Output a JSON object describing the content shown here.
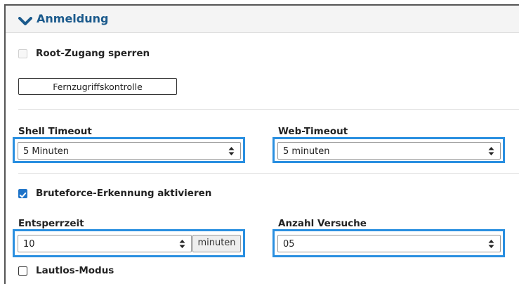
{
  "section": {
    "title": "Anmeldung",
    "icon": "chevron-down-icon"
  },
  "root_access": {
    "label": "Root-Zugang sperren",
    "checked": false,
    "disabled": true
  },
  "remote_button": {
    "label": "Fernzugriffskontrolle"
  },
  "shell_timeout": {
    "label": "Shell Timeout",
    "value": "5 Minuten"
  },
  "web_timeout": {
    "label": "Web-Timeout",
    "value": "5 minuten"
  },
  "bruteforce": {
    "label": "Bruteforce-Erkennung aktivieren",
    "checked": true
  },
  "unlock_time": {
    "label": "Entsperrzeit",
    "value": "10",
    "unit": "minuten"
  },
  "attempts": {
    "label": "Anzahl Versuche",
    "value": "05"
  },
  "silent_mode": {
    "label": "Lautlos-Modus",
    "checked": false
  },
  "colors": {
    "accent": "#1e73c8",
    "title": "#1b5a8c",
    "highlight": "#2a8fe0"
  }
}
